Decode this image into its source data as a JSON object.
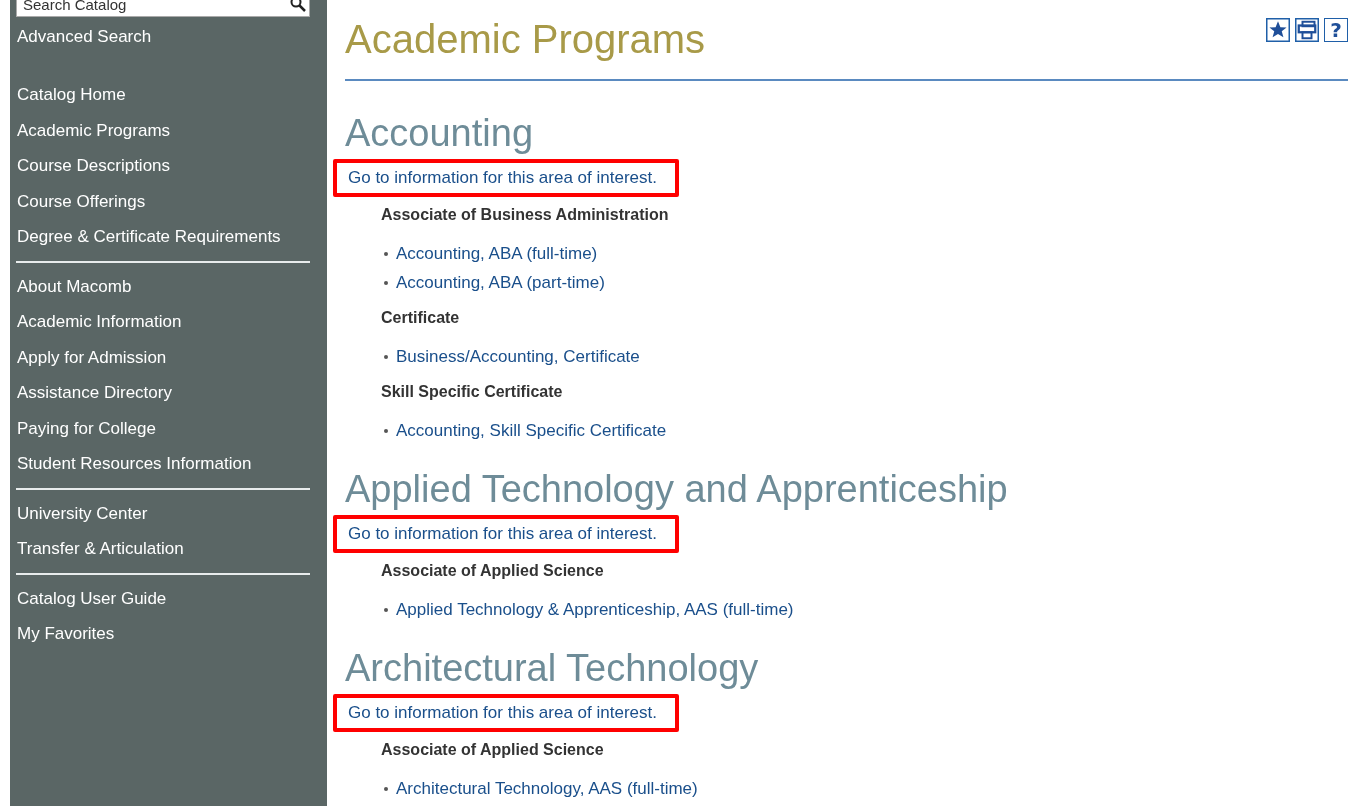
{
  "sidebar": {
    "search": {
      "placeholder": "Search Catalog"
    },
    "advanced_link": "Advanced Search",
    "groups": [
      [
        "Catalog Home",
        "Academic Programs",
        "Course Descriptions",
        "Course Offerings",
        "Degree & Certificate Requirements"
      ],
      [
        "About Macomb",
        "Academic Information",
        "Apply for Admission",
        "Assistance Directory",
        "Paying for College",
        "Student Resources Information"
      ],
      [
        "University Center",
        "Transfer & Articulation"
      ],
      [
        "Catalog User Guide",
        "My Favorites"
      ]
    ]
  },
  "page_title": "Academic Programs",
  "toolbar": [
    {
      "kind": "star"
    },
    {
      "kind": "print"
    },
    {
      "kind": "help",
      "text": "?"
    }
  ],
  "sections": [
    {
      "heading": "Accounting",
      "link": {
        "text": "Go to information for this area of interest.",
        "highlighted": true
      },
      "groups": [
        {
          "title": "Associate of Business Administration",
          "programs": [
            "Accounting, ABA (full-time)",
            "Accounting, ABA (part-time)"
          ]
        },
        {
          "title": "Certificate",
          "programs": [
            "Business/Accounting, Certificate"
          ]
        },
        {
          "title": "Skill Specific Certificate",
          "programs": [
            "Accounting, Skill Specific Certificate"
          ]
        }
      ]
    },
    {
      "heading": "Applied Technology and Apprenticeship",
      "link": {
        "text": "Go to information for this area of interest.",
        "highlighted": true
      },
      "groups": [
        {
          "title": "Associate of Applied Science",
          "programs": [
            "Applied Technology & Apprenticeship, AAS (full-time)"
          ]
        }
      ]
    },
    {
      "heading": "Architectural Technology",
      "link": {
        "text": "Go to information for this area of interest.",
        "highlighted": true
      },
      "groups": [
        {
          "title": "Associate of Applied Science",
          "programs": [
            "Architectural Technology, AAS (full-time)"
          ]
        }
      ]
    }
  ]
}
